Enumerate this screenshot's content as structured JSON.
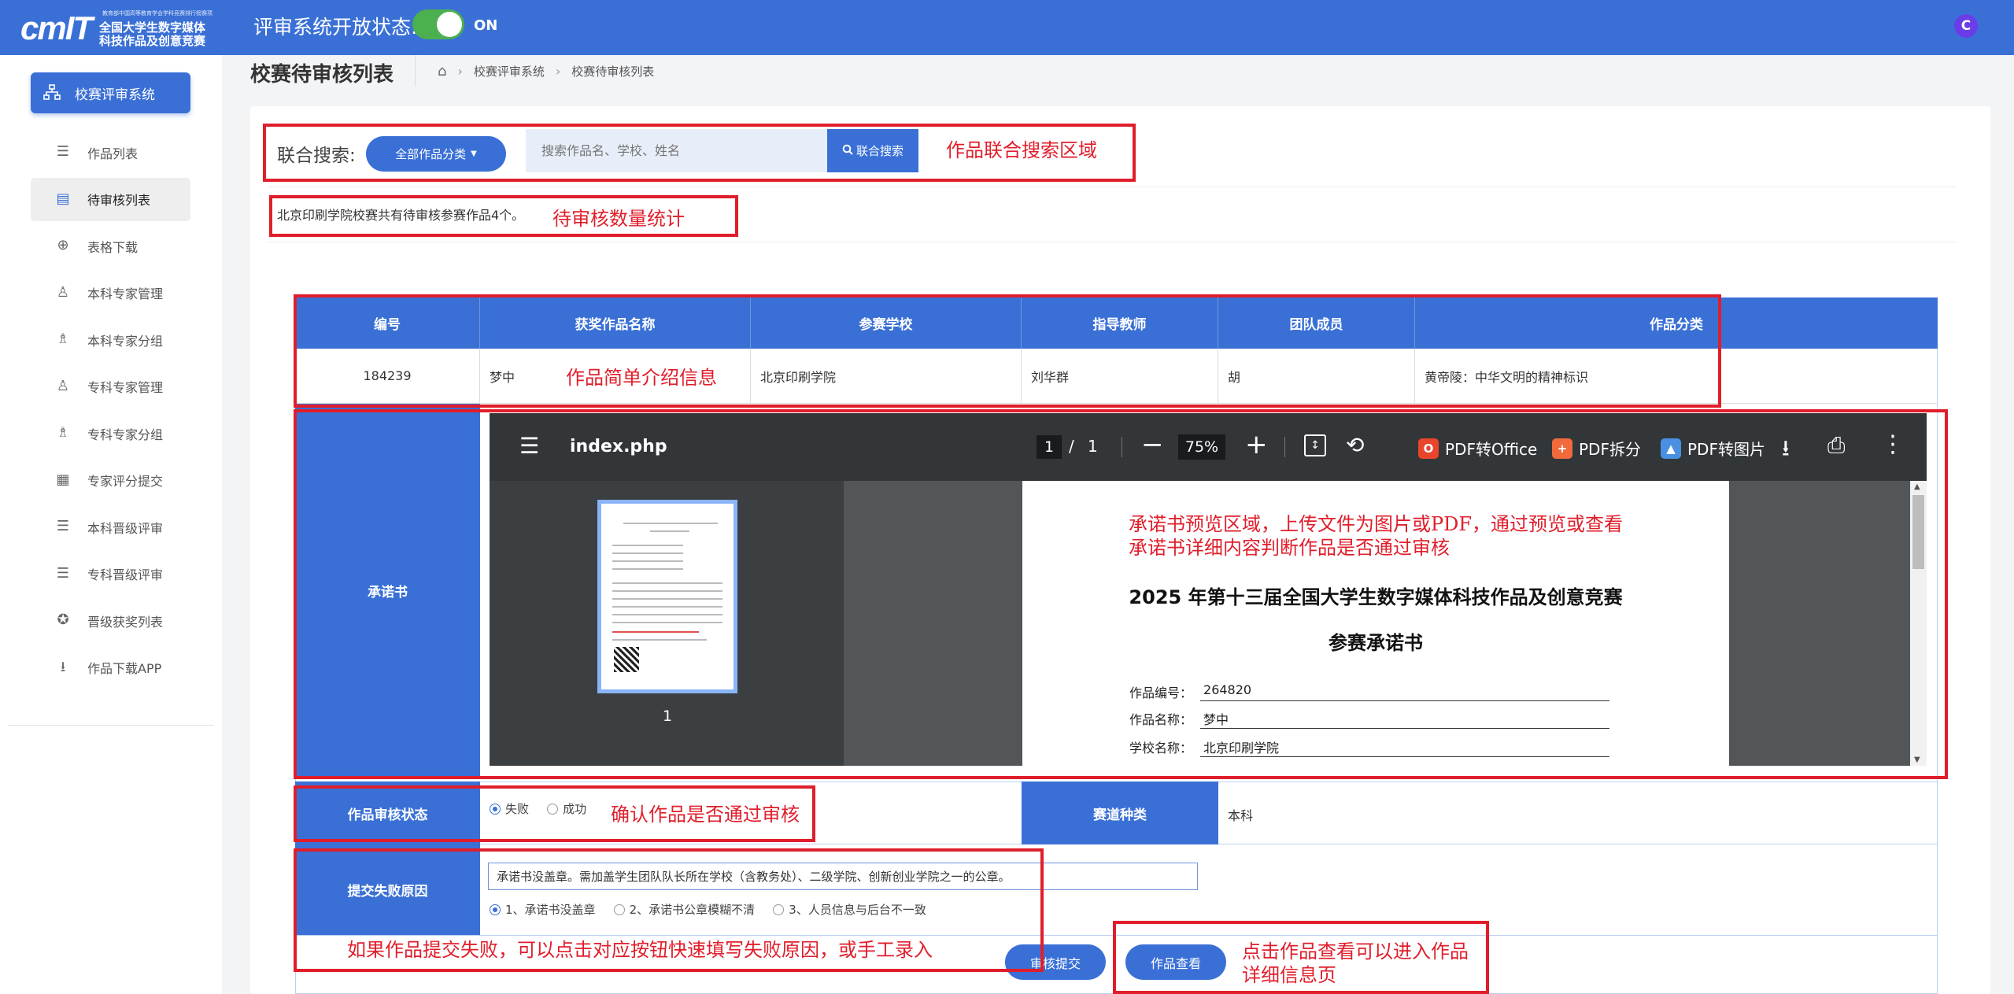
{
  "topbar": {
    "logo_text": "cmIT",
    "logo_small": "教育部中国高等教育学会学科竞赛排行榜赛项",
    "logo_line1": "全国大学生数字媒体",
    "logo_line2": "科技作品及创意竞赛",
    "status_label": "评审系统开放状态:",
    "switch_text": "ON",
    "user_initial": "C"
  },
  "sidebar": {
    "main": "校赛评审系统",
    "items": [
      {
        "label": "作品列表",
        "icon": "list-icon"
      },
      {
        "label": "待审核列表",
        "icon": "table-icon"
      },
      {
        "label": "表格下载",
        "icon": "download-circle-icon"
      },
      {
        "label": "本科专家管理",
        "icon": "user-icon"
      },
      {
        "label": "本科专家分组",
        "icon": "users-icon"
      },
      {
        "label": "专科专家管理",
        "icon": "user-icon"
      },
      {
        "label": "专科专家分组",
        "icon": "users-icon"
      },
      {
        "label": "专家评分提交",
        "icon": "calculator-icon"
      },
      {
        "label": "本科晋级评审",
        "icon": "list-icon"
      },
      {
        "label": "专科晋级评审",
        "icon": "list-icon"
      },
      {
        "label": "晋级获奖列表",
        "icon": "award-icon"
      },
      {
        "label": "作品下载APP",
        "icon": "download-icon"
      }
    ]
  },
  "header": {
    "title": "校赛待审核列表",
    "breadcrumb": [
      "校赛评审系统",
      "校赛待审核列表"
    ]
  },
  "search": {
    "label": "联合搜索:",
    "category": "全部作品分类",
    "placeholder": "搜索作品名、学校、姓名",
    "button": "联合搜索"
  },
  "count_text": "北京印刷学院校赛共有待审核参赛作品4个。",
  "table": {
    "headers": [
      "编号",
      "获奖作品名称",
      "参赛学校",
      "指导教师",
      "团队成员",
      "作品分类"
    ],
    "row": [
      "184239",
      "梦中",
      "北京印刷学院",
      "刘华群",
      "胡",
      "黄帝陵：中华文明的精神标识"
    ]
  },
  "pledge": {
    "label": "承诺书",
    "pdf": {
      "filename": "index.php",
      "page": "1",
      "total": "1",
      "zoom": "75%",
      "tools": [
        "PDF转Office",
        "PDF拆分",
        "PDF转图片"
      ],
      "thumb_num": "1",
      "doc_title": "2025 年第十三届全国大学生数字媒体科技作品及创意竞赛",
      "doc_sub": "参赛承诺书",
      "fields": [
        {
          "label": "作品编号：",
          "value": "264820"
        },
        {
          "label": "作品名称：",
          "value": "梦中"
        },
        {
          "label": "学校名称：",
          "value": "北京印刷学院"
        }
      ]
    }
  },
  "review": {
    "status_label": "作品审核状态",
    "options": [
      "失败",
      "成功"
    ],
    "track_label": "赛道种类",
    "track_value": "本科",
    "reason_label": "提交失败原因",
    "reason_value": "承诺书没盖章。需加盖学生团队队长所在学校（含教务处）、二级学院、创新创业学院之一的公章。",
    "reason_options": [
      "1、承诺书没盖章",
      "2、承诺书公章模糊不清",
      "3、人员信息与后台不一致"
    ],
    "submit": "审核提交",
    "view": "作品查看"
  },
  "annotations": {
    "search_area": "作品联合搜索区域",
    "count": "待审核数量统计",
    "intro": "作品简单介绍信息",
    "pledge_line1": "承诺书预览区域，上传文件为图片或PDF，通过预览或查看",
    "pledge_line2": "承诺书详细内容判断作品是否通过审核",
    "status": "确认作品是否通过审核",
    "reason": "如果作品提交失败，可以点击对应按钮快速填写失败原因，或手工录入",
    "view_line1": "点击作品查看可以进入作品",
    "view_line2": "详细信息页"
  },
  "colors": {
    "primary": "#3a70d6",
    "annotation": "#e01e2b",
    "switch": "#4caf50"
  }
}
